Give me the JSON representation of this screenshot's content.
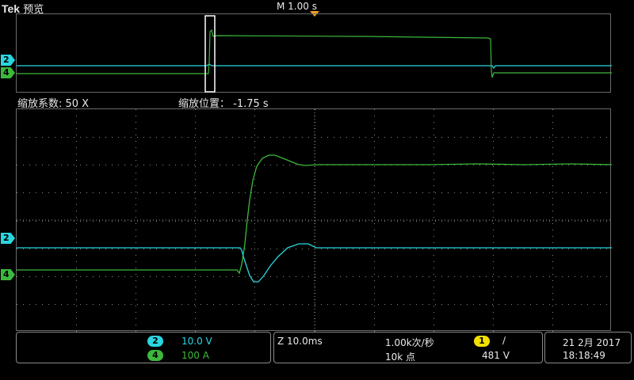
{
  "header": {
    "brand": "Tek",
    "mode": "预览",
    "timebase": "M 1.00 s",
    "trigger_marker_color": "#f0a020"
  },
  "zoom": {
    "factor_label": "缩放系数: 50 X",
    "position_label": "缩放位置： -1.75 s"
  },
  "channels": [
    {
      "id": "2",
      "color": "#2ad6e0",
      "scale": "10.0 V"
    },
    {
      "id": "4",
      "color": "#3cb83c",
      "scale": "100 A"
    }
  ],
  "acquisition": {
    "zoom_scale": "Z 10.0ms",
    "sample_rate": "1.00k次/秒",
    "record_length": "10k 点"
  },
  "trigger": {
    "source": "1",
    "source_color": "#f2e000",
    "slope_icon": "rising-edge-icon",
    "slope_glyph": "∕",
    "level": "481 V"
  },
  "clock": {
    "date": "21 2月 2017",
    "time": "18:18:49"
  }
}
